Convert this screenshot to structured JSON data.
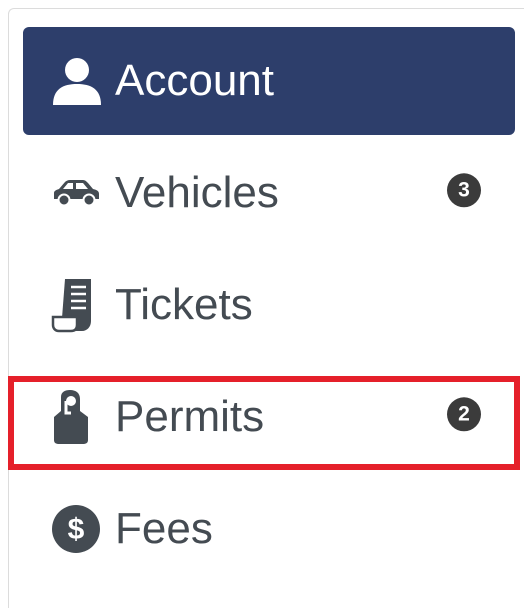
{
  "nav": {
    "items": [
      {
        "label": "Account",
        "icon": "user-icon",
        "active": true,
        "badge": ""
      },
      {
        "label": "Vehicles",
        "icon": "car-icon",
        "active": false,
        "badge": "3"
      },
      {
        "label": "Tickets",
        "icon": "receipt-icon",
        "active": false,
        "badge": ""
      },
      {
        "label": "Permits",
        "icon": "door-hanger-icon",
        "active": false,
        "badge": "2"
      },
      {
        "label": "Fees",
        "icon": "dollar-circle-icon",
        "active": false,
        "badge": ""
      }
    ]
  },
  "colors": {
    "active_bg": "#2d3e6b",
    "text": "#444b52",
    "badge_bg": "#3b3b3b",
    "highlight": "#e5202a"
  }
}
